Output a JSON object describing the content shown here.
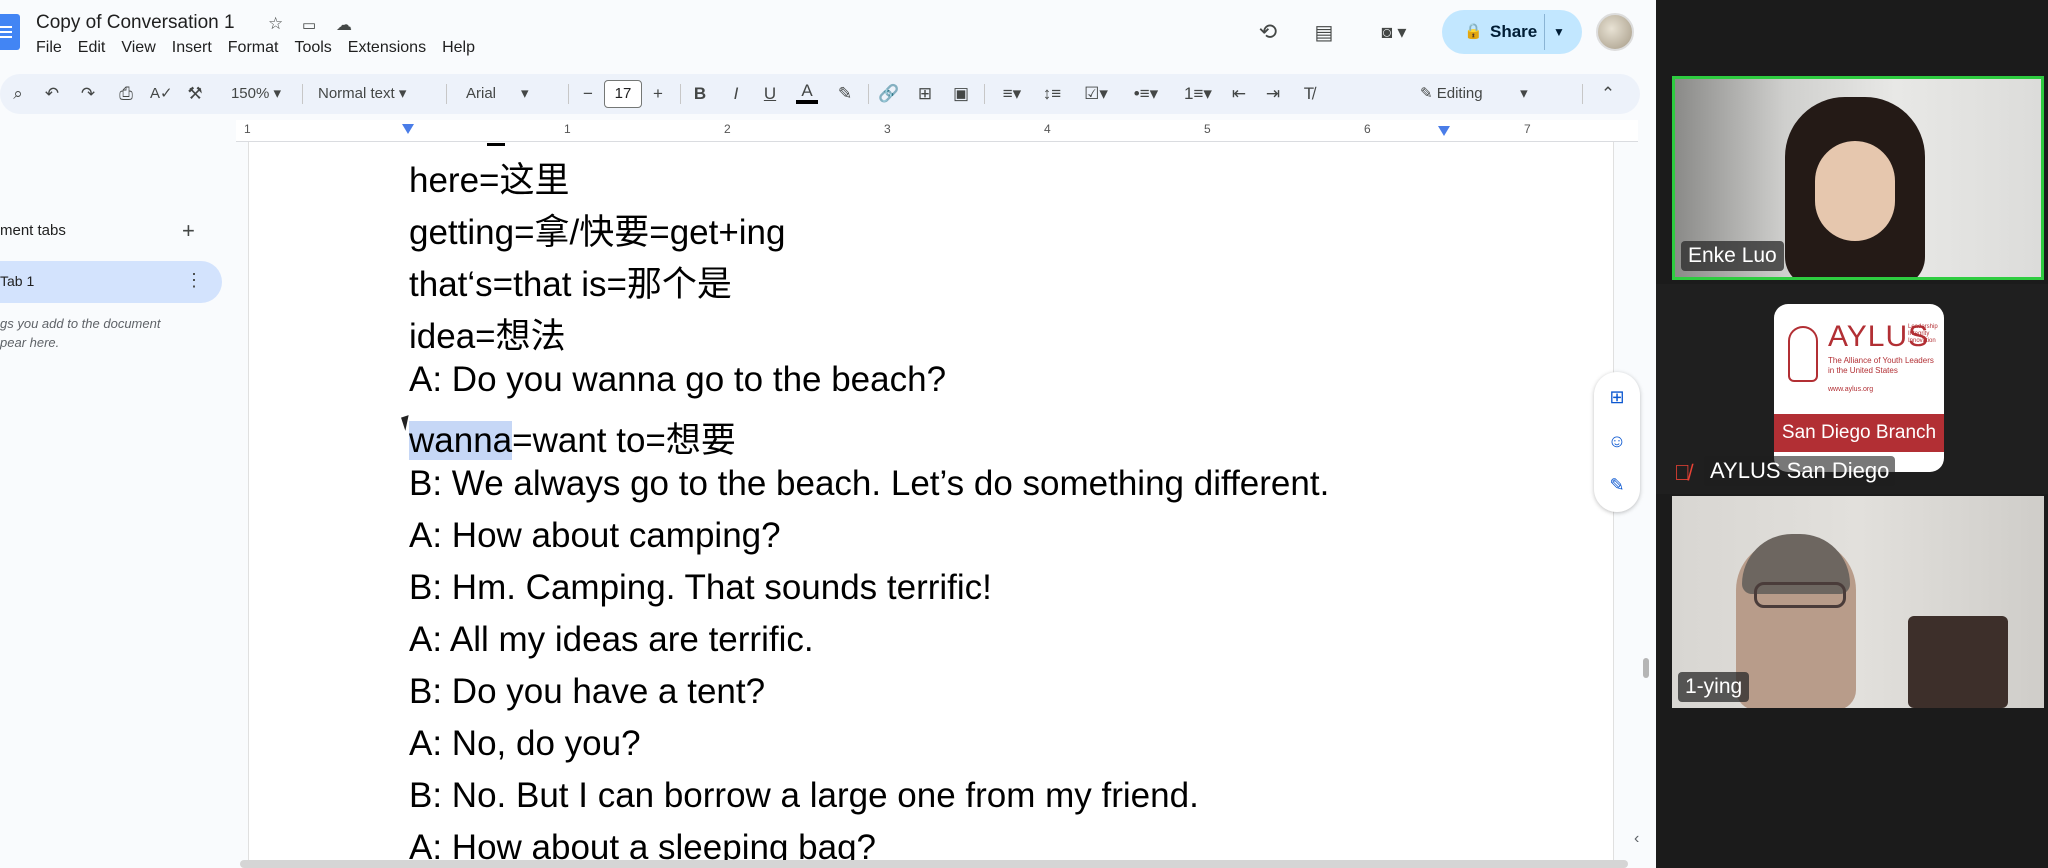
{
  "docs": {
    "title": "Copy of Conversation 1",
    "menu": [
      "File",
      "Edit",
      "View",
      "Insert",
      "Format",
      "Tools",
      "Extensions",
      "Help"
    ],
    "share_label": "Share",
    "toolbar": {
      "zoom": "150%",
      "style": "Normal text",
      "font": "Arial",
      "font_size": "17",
      "mode": "Editing",
      "bold": "B",
      "italic": "I",
      "underline": "U",
      "text_color": "A"
    },
    "ruler_numbers": [
      "1",
      "1",
      "2",
      "3",
      "4",
      "5",
      "6",
      "7"
    ],
    "sidebar": {
      "title": "ment tabs",
      "tab_label": "Tab 1",
      "hint_line1": "gs you add to the document",
      "hint_line2": "pear here."
    },
    "lines": [
      "here=这里",
      "getting=拿/快要=get+ing",
      "that‘s=that is=那个是",
      "idea=想法",
      "A: Do you wanna go to the beach?",
      "=want to=想要",
      "B: We always go to the beach. Let’s do something different.",
      "A: How about camping?",
      "B: Hm. Camping. That sounds terrific!",
      "A: All my ideas are terrific.",
      "B: Do you have a tent?",
      "A: No, do you?",
      "B: No. But I can borrow a large one from my friend.",
      "A: How about a sleeping bag?"
    ],
    "selected_word": "wanna"
  },
  "meet": {
    "participant1": "Enke Luo",
    "participant2": "AYLUS San Diego",
    "participant3": "1-ying",
    "logo": {
      "name": "AYLUS",
      "subtitle": "The Alliance of Youth Leaders in the United States",
      "tagline": "Leadership Integrity Innovation",
      "url": "www.aylus.org",
      "branch": "San Diego Branch"
    }
  },
  "colors": {
    "accent": "#0b57d0",
    "share_bg": "#c2e7ff",
    "selection": "#c6d7f6",
    "speaker_border": "#2ecc40",
    "aylus_red": "#b22f34"
  },
  "icons": {
    "docs_logo": "docs-logo-icon",
    "star": "star-icon",
    "history": "history-icon",
    "comments": "comment-icon",
    "meet": "video-icon",
    "lock": "lock-icon"
  }
}
